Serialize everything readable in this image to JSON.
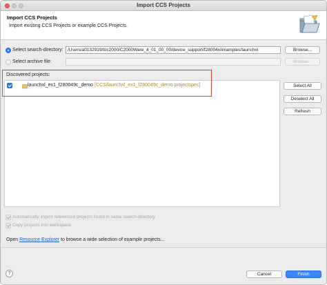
{
  "window": {
    "title": "Import CCS Projects"
  },
  "header": {
    "title": "Import CCS Projects",
    "description": "Import existing CCS Projects or example CCS Projects."
  },
  "search_directory": {
    "label": "Select search-directory:",
    "value": "/Users/a0132919/ti/c2000/C2000Ware_4_01_00_00/device_support/f28004x/examples/launchxl",
    "browse_label": "Browse...",
    "selected": true
  },
  "archive_file": {
    "label": "Select archive file:",
    "value": "",
    "browse_label": "Browse...",
    "selected": false
  },
  "discovered": {
    "label": "Discovered projects:",
    "projects": [
      {
        "name": "launchxl_ex1_f280049c_demo",
        "path": "[CCS/launchxl_ex1_f280049c_demo.projectspec]",
        "checked": true
      }
    ],
    "buttons": {
      "select_all": "Select All",
      "deselect_all": "Deselect All",
      "refresh": "Refresh"
    }
  },
  "options": {
    "auto_import": "Automatically import referenced projects found in same search-directory",
    "copy_projects": "Copy projects into workspace"
  },
  "resource_explorer": {
    "prefix": "Open",
    "link": "Resource Explorer",
    "suffix": "to browse a wide selection of example projects..."
  },
  "footer": {
    "help": "?",
    "cancel": "Cancel",
    "finish": "Finish"
  },
  "colors": {
    "accent": "#2f7bf6",
    "highlight_box": "#d9442f",
    "project_path": "#b08a2e",
    "link": "#1f5fd3"
  }
}
